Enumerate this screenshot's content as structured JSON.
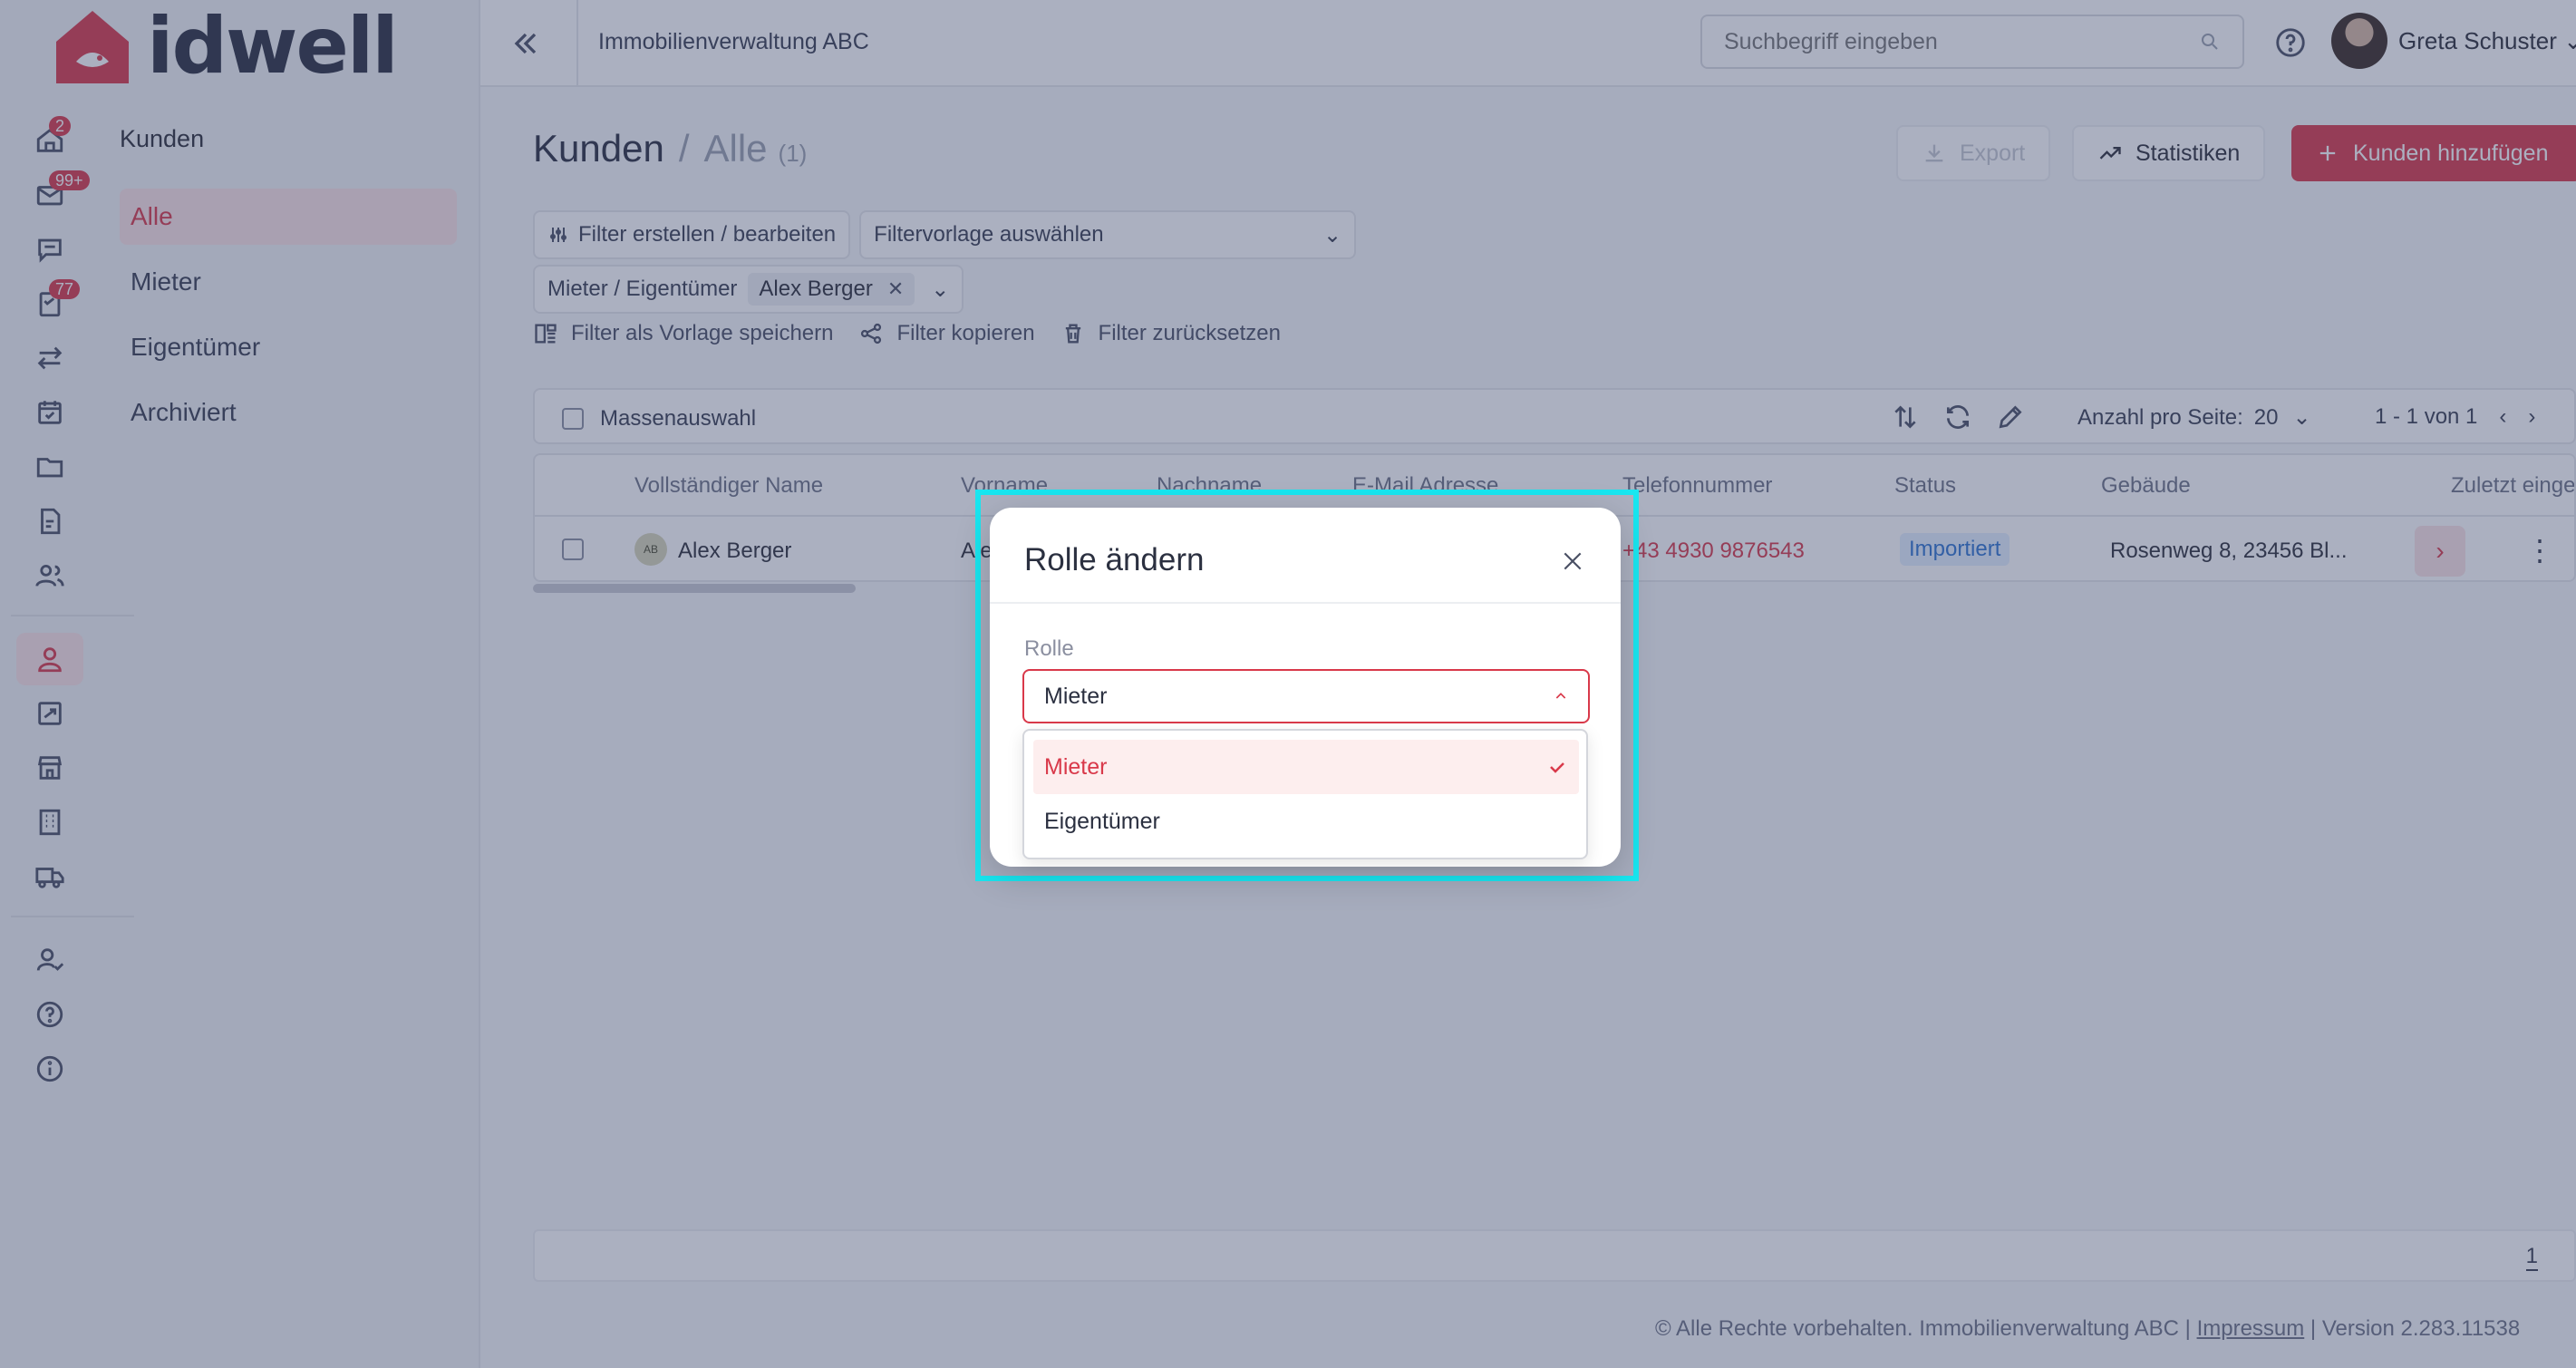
{
  "brand": {
    "name": "idwell",
    "color": "#d9394a"
  },
  "rail": {
    "items": [
      {
        "icon": "home-icon",
        "badge": "2"
      },
      {
        "icon": "mail-icon",
        "badge": "99+"
      },
      {
        "icon": "chat-icon",
        "badge": ""
      },
      {
        "icon": "tasks-icon",
        "badge": "77"
      },
      {
        "icon": "transfer-icon",
        "badge": ""
      },
      {
        "icon": "calendar-icon",
        "badge": ""
      },
      {
        "icon": "folder-icon",
        "badge": ""
      },
      {
        "icon": "document-edit-icon",
        "badge": ""
      },
      {
        "icon": "users-icon",
        "badge": ""
      },
      {
        "icon": "person-icon",
        "badge": "",
        "active": true
      },
      {
        "icon": "contract-icon",
        "badge": ""
      },
      {
        "icon": "store-icon",
        "badge": ""
      },
      {
        "icon": "building-icon",
        "badge": ""
      },
      {
        "icon": "truck-icon",
        "badge": ""
      },
      {
        "icon": "user-check-icon",
        "badge": ""
      },
      {
        "icon": "help-icon",
        "badge": ""
      },
      {
        "icon": "info-icon",
        "badge": ""
      }
    ]
  },
  "sidebar": {
    "section_title": "Kunden",
    "items": [
      {
        "label": "Alle",
        "active": true
      },
      {
        "label": "Mieter"
      },
      {
        "label": "Eigentümer"
      },
      {
        "label": "Archiviert"
      }
    ]
  },
  "topbar": {
    "org_name": "Immobilienverwaltung ABC",
    "search_placeholder": "Suchbegriff eingeben",
    "user_name": "Greta Schuster"
  },
  "page": {
    "title": "Kunden",
    "separator": "/",
    "subtitle": "Alle",
    "count": "(1)",
    "export_label": "Export",
    "stats_label": "Statistiken",
    "add_label": "Kunden hinzufügen"
  },
  "filters": {
    "edit_label": "Filter erstellen / bearbeiten",
    "template_placeholder": "Filtervorlage auswählen",
    "active_filter_label": "Mieter / Eigentümer",
    "active_filter_value": "Alex Berger",
    "save_template_label": "Filter als Vorlage speichern",
    "copy_label": "Filter kopieren",
    "reset_label": "Filter zurücksetzen"
  },
  "toolbar": {
    "bulk_label": "Massenauswahl",
    "per_page_label": "Anzahl pro Seite:",
    "per_page_value": "20",
    "pagination": "1 - 1 von 1"
  },
  "table": {
    "columns": [
      "Vollständiger Name",
      "Vorname",
      "Nachname",
      "E-Mail Adresse",
      "Telefonnummer",
      "Status",
      "Gebäude",
      "Zuletzt einge"
    ],
    "rows": [
      {
        "initials": "AB",
        "full_name": "Alex Berger",
        "first_name": "Ale",
        "phone": "+43 4930 9876543",
        "status": "Importiert",
        "building": "Rosenweg 8, 23456 Bl..."
      }
    ]
  },
  "footer": {
    "page": "1",
    "copyright": "© Alle Rechte vorbehalten. Immobilienverwaltung ABC |",
    "impressum": "Impressum",
    "version": "| Version 2.283.11538"
  },
  "modal": {
    "title": "Rolle ändern",
    "field_label": "Rolle",
    "selected_value": "Mieter",
    "options": [
      {
        "label": "Mieter",
        "selected": true
      },
      {
        "label": "Eigentümer",
        "selected": false
      }
    ]
  }
}
